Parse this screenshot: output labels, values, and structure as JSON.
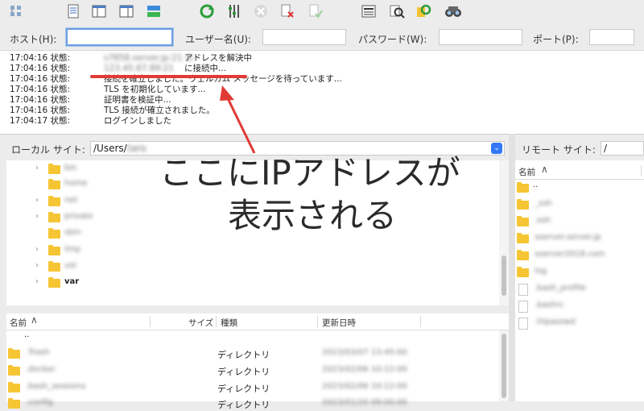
{
  "toolbar": {
    "icons": [
      "site-manager-icon",
      "message-log-icon",
      "local-tree-icon",
      "remote-tree-icon",
      "transfer-queue-icon",
      "refresh-icon",
      "process-queue-icon",
      "cancel-icon",
      "disconnect-icon",
      "reconnect-icon",
      "directory-listing-filter-icon",
      "compare-icon",
      "sync-browse-icon",
      "search-icon"
    ]
  },
  "quickconnect": {
    "host_label": "ホスト(H):",
    "host_value": "",
    "user_label": "ユーザー名(U):",
    "user_value": "",
    "password_label": "パスワード(W):",
    "password_value": "",
    "port_label": "ポート(P):",
    "port_value": ""
  },
  "log": [
    {
      "time": "17:04:16 状態:",
      "msg": "アドレスを解決中",
      "blurred": "s7858.server.jp:21 の"
    },
    {
      "time": "17:04:16 状態:",
      "msg": "に接続中...",
      "blurred": "123.45.67.89:21"
    },
    {
      "time": "17:04:16 状態:",
      "msg": "接続を確立しました。ウェルカム メッセージを待っています...",
      "blurred": ""
    },
    {
      "time": "17:04:16 状態:",
      "msg": "TLS を初期化しています...",
      "blurred": ""
    },
    {
      "time": "17:04:16 状態:",
      "msg": "証明書を検証中...",
      "blurred": ""
    },
    {
      "time": "17:04:16 状態:",
      "msg": "TLS 接続が確立されました。",
      "blurred": ""
    },
    {
      "time": "17:04:17 状態:",
      "msg": "ログインしました",
      "blurred": ""
    }
  ],
  "annotation": {
    "line1": "ここにIPアドレスが",
    "line2": "表示される",
    "color": "#e03a35"
  },
  "local": {
    "site_label": "ローカル サイト:",
    "path": "/Users/",
    "path_blurred": "taro",
    "tree": [
      {
        "name": "bin",
        "expandable": true
      },
      {
        "name": "home",
        "expandable": false
      },
      {
        "name": "net",
        "expandable": true
      },
      {
        "name": "private",
        "expandable": true
      },
      {
        "name": "sbin",
        "expandable": false
      },
      {
        "name": "tmp",
        "expandable": true
      },
      {
        "name": "usr",
        "expandable": true
      },
      {
        "name": "var",
        "expandable": true
      }
    ],
    "columns": {
      "name": "名前",
      "size": "サイズ",
      "type": "種類",
      "modified": "更新日時"
    },
    "files": [
      {
        "name": "..",
        "type": "",
        "date": ""
      },
      {
        "name": ".Trash",
        "type": "ディレクトリ",
        "date": "2023/03/07 13:45:00"
      },
      {
        "name": ".docker",
        "type": "ディレクトリ",
        "date": "2023/02/06 10:12:00"
      },
      {
        "name": ".bash_sessions",
        "type": "ディレクトリ",
        "date": "2023/02/06 10:12:00"
      },
      {
        "name": ".config",
        "type": "ディレクトリ",
        "date": "2023/01/20 09:00:00"
      }
    ]
  },
  "remote": {
    "site_label": "リモート サイト:",
    "path": "/",
    "columns": {
      "name": "名前"
    },
    "files": [
      {
        "name": "..",
        "kind": "folder",
        "blurred": false
      },
      {
        "name": "_ssh",
        "kind": "folder",
        "blurred": true
      },
      {
        "name": ".ssh",
        "kind": "folder",
        "blurred": true
      },
      {
        "name": "xserver.server.jp",
        "kind": "folder",
        "blurred": true
      },
      {
        "name": "xserver2018.com",
        "kind": "folder",
        "blurred": true
      },
      {
        "name": "log",
        "kind": "folder",
        "blurred": true
      },
      {
        "name": ".bash_profile",
        "kind": "file",
        "blurred": true
      },
      {
        "name": ".bashrc",
        "kind": "file",
        "blurred": true
      },
      {
        "name": ".htpasswd",
        "kind": "file",
        "blurred": true
      }
    ]
  }
}
